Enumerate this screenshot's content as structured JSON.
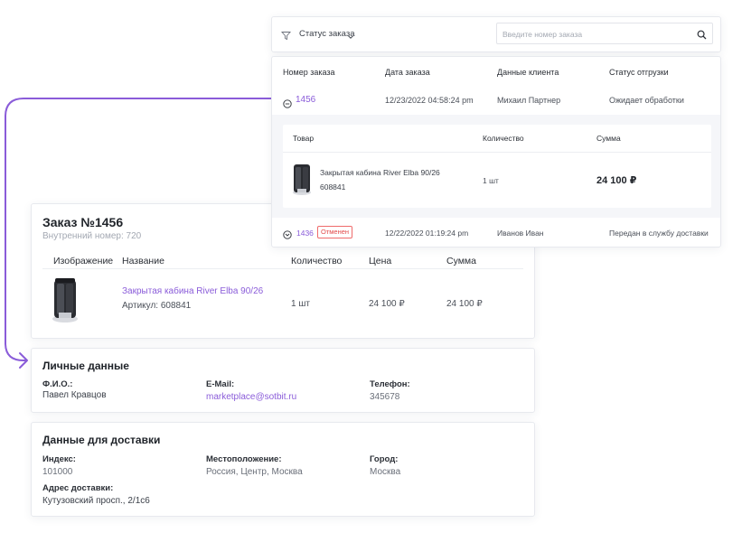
{
  "colors": {
    "accent": "#8a5cd9",
    "danger": "#e24a4a",
    "border": "#e7e9ee"
  },
  "filter": {
    "status_label": "Статус заказа",
    "search_placeholder": "Введите номер заказа",
    "filter_icon": "filter-icon",
    "search_icon": "search-icon"
  },
  "orders_list": {
    "columns": [
      "Номер заказа",
      "Дата заказа",
      "Данные клиента",
      "Статус отгрузки"
    ],
    "rows": [
      {
        "number": "1456",
        "date": "12/23/2022 04:58:24 pm",
        "client": "Михаил Партнер",
        "status": "Ожидает обработки",
        "expanded": true
      },
      {
        "number": "1436",
        "badge": "Отменен",
        "date": "12/22/2022 01:19:24 pm",
        "client": "Иванов Иван",
        "status": "Передан в службу доставки",
        "expanded": false
      }
    ],
    "details": {
      "columns": [
        "Товар",
        "Количество",
        "Сумма"
      ],
      "item": {
        "name": "Закрытая кабина River Elba 90/26",
        "article": "608841",
        "qty": "1 шт",
        "sum": "24 100 ₽"
      }
    }
  },
  "order": {
    "title": "Заказ №1456",
    "internal": "Внутренний номер: 720",
    "columns": [
      "Изображение",
      "Название",
      "Количество",
      "Цена",
      "Сумма"
    ],
    "item": {
      "name": "Закрытая кабина River Elba 90/26",
      "article": "Артикул: 608841",
      "qty": "1 шт",
      "price": "24 100 ₽",
      "sum": "24 100 ₽"
    }
  },
  "personal": {
    "title": "Личные данные",
    "name_label": "Ф.И.О.:",
    "name": "Павел Кравцов",
    "email_label": "E-Mail:",
    "email": "marketplace@sotbit.ru",
    "phone_label": "Телефон:",
    "phone": "345678"
  },
  "delivery": {
    "title": "Данные для доставки",
    "index_label": "Индекс:",
    "index": "101000",
    "location_label": "Местоположение:",
    "location": "Россия, Центр, Москва",
    "city_label": "Город:",
    "city": "Москва",
    "address_label": "Адрес доставки:",
    "address": "Кутузовский просп., 2/1с6"
  }
}
